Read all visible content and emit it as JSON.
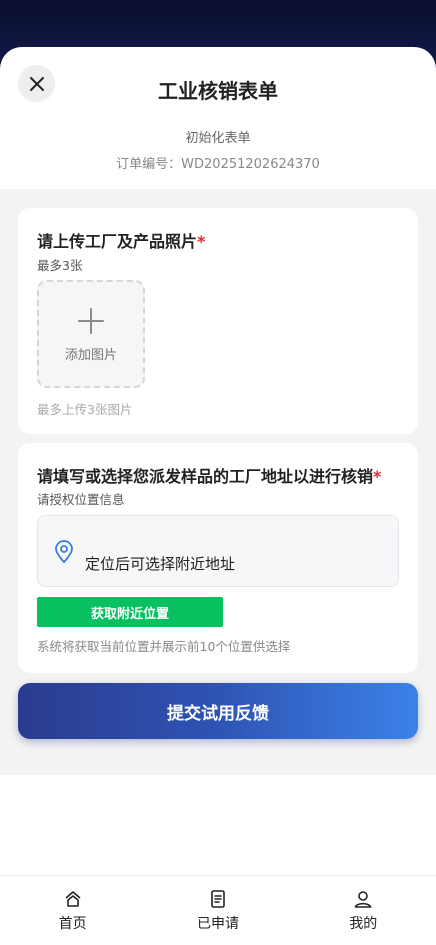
{
  "header": {
    "title": "工业核销表单",
    "status": "初始化表单",
    "order_label": "订单编号：",
    "order_number": "WD20251202624370"
  },
  "photos": {
    "title": "请上传工厂及产品照片",
    "required_mark": "*",
    "subtitle": "最多3张",
    "add_label": "添加图片",
    "hint": "最多上传3张图片"
  },
  "address": {
    "title": "请填写或选择您派发样品的工厂地址以进行核销",
    "required_mark": "*",
    "subtitle": "请授权位置信息",
    "location_placeholder": "定位后可选择附近地址",
    "nearby_button": "获取附近位置",
    "hint": "系统将获取当前位置并展示前10个位置供选择"
  },
  "submit_label": "提交试用反馈",
  "tabbar": {
    "items": [
      {
        "label": "首页",
        "icon": "home-icon"
      },
      {
        "label": "已申请",
        "icon": "document-icon"
      },
      {
        "label": "我的",
        "icon": "user-icon"
      }
    ]
  },
  "colors": {
    "accent_green": "#07c160",
    "required_red": "#e0262b",
    "submit_gradient_start": "#2a3b8f",
    "submit_gradient_end": "#3b82e8"
  }
}
